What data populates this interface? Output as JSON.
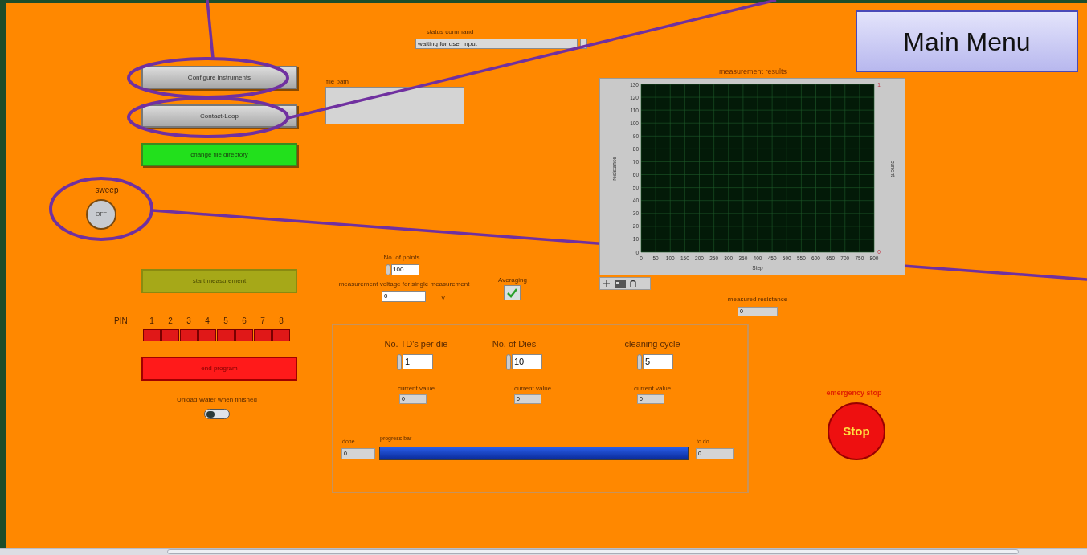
{
  "status_command": {
    "label": "status command",
    "value": "waiting for user input"
  },
  "buttons": [
    {
      "label": "Configure instruments",
      "kind": "normal"
    },
    {
      "label": "Contact-Loop",
      "kind": "normal"
    },
    {
      "label": "change file directory",
      "kind": "go"
    }
  ],
  "file_path": {
    "label": "file path"
  },
  "sweep": {
    "label": "sweep",
    "text": "OFF",
    "on": false
  },
  "start_button": {
    "label": "start measurement",
    "disabled": true
  },
  "pins": {
    "label": "PIN",
    "items": [
      {
        "label": "1",
        "on": false
      },
      {
        "label": "2",
        "on": false
      },
      {
        "label": "3",
        "on": false
      },
      {
        "label": "4",
        "on": false
      },
      {
        "label": "5",
        "on": false
      },
      {
        "label": "6",
        "on": false
      },
      {
        "label": "7",
        "on": false
      },
      {
        "label": "8",
        "on": false
      }
    ]
  },
  "end_button": {
    "label": "end program"
  },
  "unload": {
    "label": "Unload Wafer when finished",
    "on": false
  },
  "points": {
    "label": "No. of points",
    "value": "100"
  },
  "voltage": {
    "label": "measurement voltage for single measurement",
    "value": "0",
    "unit": "V"
  },
  "averaging": {
    "label": "Averaging",
    "checked": true
  },
  "chart": {
    "chart_data": {
      "type": "line",
      "title": "measurement results",
      "xlabel": "Step",
      "ylabel": "resistance",
      "xlim": [
        0,
        800
      ],
      "ylim": [
        0,
        130
      ],
      "xticks": [
        0,
        50,
        100,
        150,
        200,
        250,
        300,
        350,
        400,
        450,
        500,
        550,
        600,
        650,
        700,
        750,
        800
      ],
      "yticks": [
        0,
        10,
        20,
        30,
        40,
        50,
        60,
        70,
        80,
        90,
        100,
        110,
        120,
        130
      ],
      "grid": true
    },
    "y2label": "current",
    "y2ticks": [
      "1",
      "0"
    ]
  },
  "measured_resistance": {
    "label": "measured resistance",
    "value": "0"
  },
  "counters": [
    {
      "label": "No. TD's per die",
      "value": "1",
      "current_label": "current value",
      "current": "0"
    },
    {
      "label": "No. of Dies",
      "value": "10",
      "current_label": "current value",
      "current": "0"
    },
    {
      "label": "cleaning cycle",
      "value": "5",
      "current_label": "current value",
      "current": "0"
    }
  ],
  "progress": {
    "done_label": "done",
    "done": "0",
    "label": "progress bar",
    "level": 1,
    "todo_label": "to do",
    "todo": "0"
  },
  "emergency": {
    "label": "emergency stop",
    "button": "Stop"
  },
  "annotation": {
    "title": "Main Menu"
  }
}
